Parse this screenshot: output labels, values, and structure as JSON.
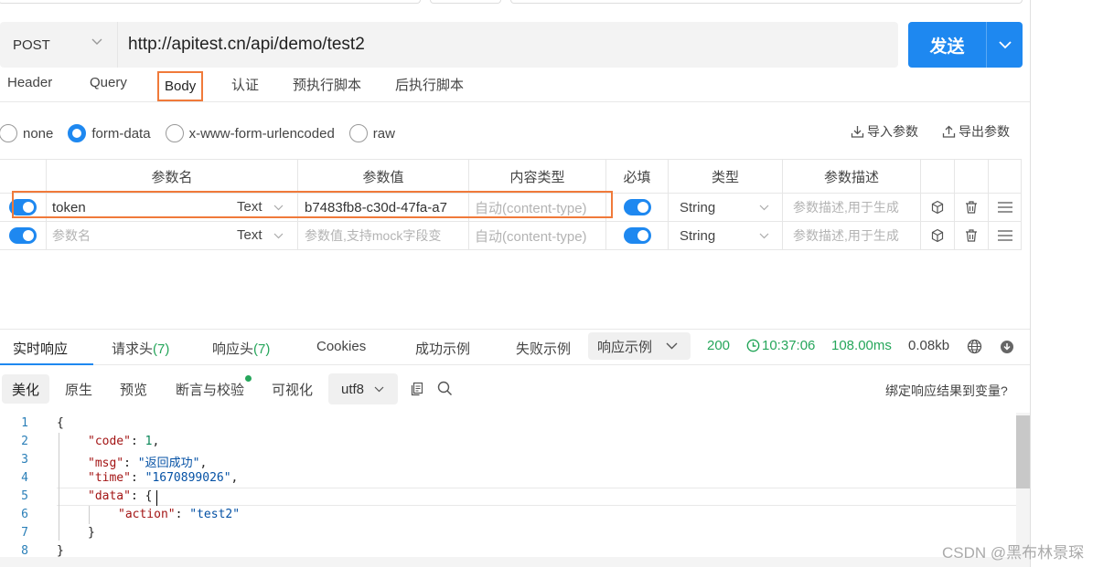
{
  "request": {
    "method": "POST",
    "url": "http://apitest.cn/api/demo/test2",
    "send_label": "发送"
  },
  "request_tabs": [
    "Header",
    "Query",
    "Body",
    "认证",
    "预执行脚本",
    "后执行脚本"
  ],
  "active_request_tab": "Body",
  "body_types": [
    "none",
    "form-data",
    "x-www-form-urlencoded",
    "raw"
  ],
  "selected_body_type": "form-data",
  "import_label": "导入参数",
  "export_label": "导出参数",
  "params_table": {
    "headers": [
      "参数名",
      "参数值",
      "内容类型",
      "必填",
      "类型",
      "参数描述"
    ],
    "rows": [
      {
        "enabled": true,
        "name": "token",
        "name_placeholder": "",
        "value_type": "Text",
        "value": "b7483fb8-c30d-47fa-a7",
        "value_placeholder": "",
        "content_type_placeholder": "自动(content-type)",
        "required": true,
        "type": "String",
        "desc_placeholder": "参数描述,用于生成"
      },
      {
        "enabled": true,
        "name": "",
        "name_placeholder": "参数名",
        "value_type": "Text",
        "value": "",
        "value_placeholder": "参数值,支持mock字段变",
        "content_type_placeholder": "自动(content-type)",
        "required": true,
        "type": "String",
        "desc_placeholder": "参数描述,用于生成"
      }
    ]
  },
  "response_tabs": [
    {
      "label": "实时响应",
      "count": ""
    },
    {
      "label": "请求头",
      "count": "(7)"
    },
    {
      "label": "响应头",
      "count": "(7)"
    },
    {
      "label": "Cookies",
      "count": ""
    },
    {
      "label": "成功示例",
      "count": ""
    },
    {
      "label": "失败示例",
      "count": ""
    }
  ],
  "response_example_select": "响应示例",
  "response_status": {
    "code": "200",
    "time": "10:37:06",
    "duration": "108.00ms",
    "size": "0.08kb"
  },
  "view_modes": [
    "美化",
    "原生",
    "预览",
    "断言与校验",
    "可视化"
  ],
  "active_view_mode": "美化",
  "encoding": "utf8",
  "bind_response_label": "绑定响应结果到变量?",
  "code_lines": [
    {
      "num": "1",
      "text": "{"
    },
    {
      "num": "2",
      "key": "\"code\"",
      "val": "1",
      "kind": "num",
      "tail": ","
    },
    {
      "num": "3",
      "key": "\"msg\"",
      "val": "\"返回成功\"",
      "kind": "str",
      "tail": ","
    },
    {
      "num": "4",
      "key": "\"time\"",
      "val": "\"1670899026\"",
      "kind": "str",
      "tail": ","
    },
    {
      "num": "5",
      "key": "\"data\"",
      "val": "{",
      "kind": "plain",
      "tail": ""
    },
    {
      "num": "6",
      "key": "\"action\"",
      "val": "\"test2\"",
      "kind": "str",
      "tail": ""
    },
    {
      "num": "7",
      "text": "}"
    },
    {
      "num": "8",
      "text": "}"
    }
  ],
  "watermark": "CSDN @黑布林景琛",
  "colors": {
    "primary": "#1e88f0",
    "highlight": "#f07a3a",
    "success": "#26a65b"
  }
}
